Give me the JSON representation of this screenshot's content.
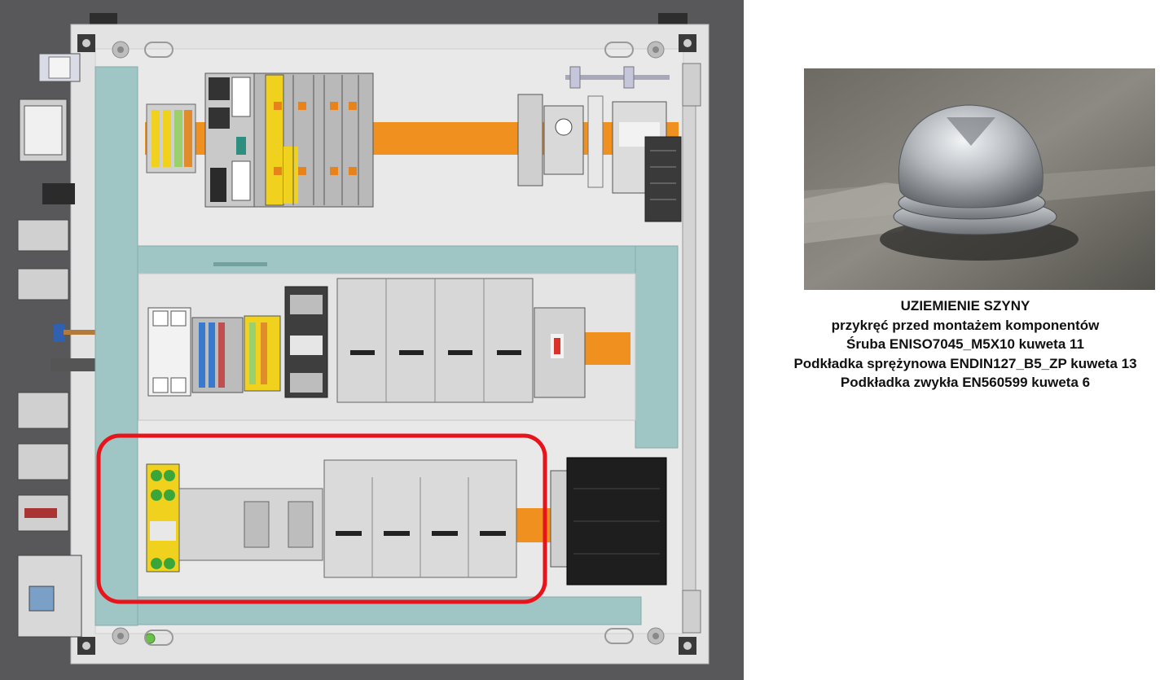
{
  "instruction": {
    "title": "UZIEMIENIE SZYNY",
    "lines": [
      "przykręć przed montażem komponentów",
      "Śruba ENISO7045_M5X10  kuweta 11",
      "Podkładka sprężynowa ENDIN127_B5_ZP kuweta 13",
      "Podkładka zwykła EN560599 kuweta 6"
    ]
  },
  "colors": {
    "enclosure_frame": "#58585a",
    "backplate": "#e3e3e3",
    "cable_duct": "#9fc6c4",
    "din_rail": "#f0901e",
    "highlight": "#e8141b",
    "terminal_yellow": "#f0d21e",
    "power_supply": "#1e1e1e"
  }
}
